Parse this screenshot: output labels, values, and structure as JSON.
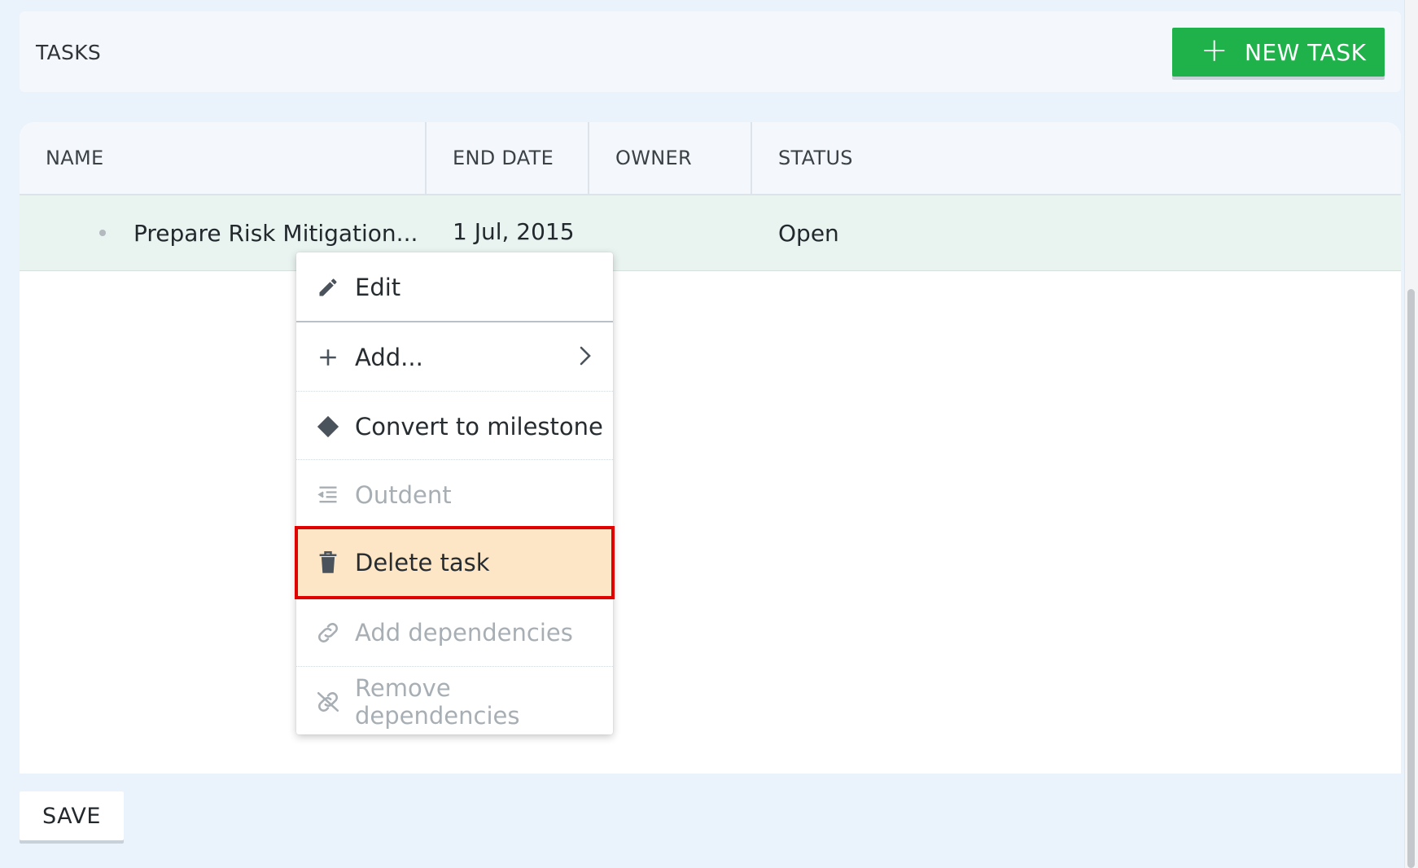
{
  "header": {
    "title": "TASKS",
    "new_task_label": "NEW TASK"
  },
  "grid": {
    "columns": [
      "NAME",
      "END DATE",
      "OWNER",
      "STATUS"
    ],
    "rows": [
      {
        "name": "Prepare Risk Mitigation...",
        "end_date": "1 Jul, 2015",
        "owner": "",
        "status": "Open"
      }
    ]
  },
  "context_menu": {
    "items": [
      {
        "label": "Edit",
        "icon": "pencil-icon",
        "disabled": false
      },
      {
        "label": "Add...",
        "icon": "plus-icon",
        "disabled": false,
        "submenu": true
      },
      {
        "label": "Convert to milestone",
        "icon": "diamond-icon",
        "disabled": false
      },
      {
        "label": "Outdent",
        "icon": "outdent-icon",
        "disabled": true
      },
      {
        "label": "Delete task",
        "icon": "trash-icon",
        "disabled": false,
        "highlighted": true
      },
      {
        "label": "Add dependencies",
        "icon": "link-icon",
        "disabled": true
      },
      {
        "label": "Remove dependencies",
        "icon": "unlink-icon",
        "disabled": true
      }
    ]
  },
  "footer": {
    "save_label": "SAVE"
  },
  "colors": {
    "primary_green": "#1fb24a",
    "highlight_bg": "#fde6c6",
    "highlight_border": "#e00000",
    "row_selected_bg": "#e9f3f0"
  }
}
